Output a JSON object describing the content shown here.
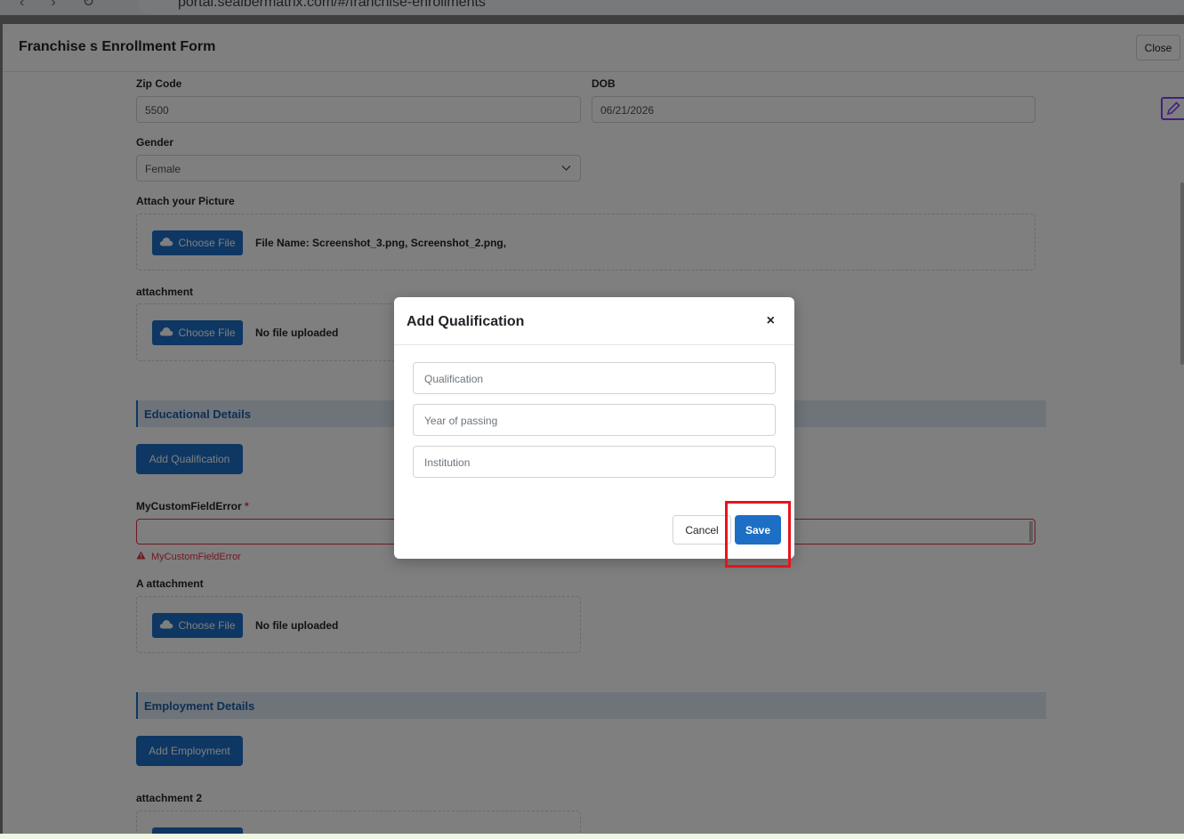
{
  "browser": {
    "url": "portal.sealbermatrix.com/#/franchise-enrollments"
  },
  "header": {
    "title": "Franchise s Enrollment Form",
    "close_label": "Close"
  },
  "form": {
    "zip_label": "Zip Code",
    "zip_value": "5500",
    "dob_label": "DOB",
    "dob_value": "06/21/2026",
    "gender_label": "Gender",
    "gender_value": "Female",
    "picture_label": "Attach your Picture",
    "choose_file_label": "Choose File",
    "picture_file_text": "File Name:  Screenshot_3.png, Screenshot_2.png,",
    "attachment_label": "attachment",
    "no_file_text": "No file uploaded",
    "educational_section": "Educational Details",
    "add_qualification_label": "Add Qualification",
    "custom_field_label": "MyCustomFieldError",
    "required_mark": "*",
    "custom_field_error": "MyCustomFieldError",
    "a_attachment_label": "A attachment",
    "employment_section": "Employment Details",
    "add_employment_label": "Add Employment",
    "attachment2_label": "attachment 2"
  },
  "modal": {
    "title": "Add Qualification",
    "close_symbol": "×",
    "qualification_placeholder": "Qualification",
    "year_placeholder": "Year of passing",
    "institution_placeholder": "Institution",
    "cancel_label": "Cancel",
    "save_label": "Save"
  },
  "colors": {
    "primary": "#1d6fc6",
    "error": "#dc3545",
    "highlight": "#e8141b",
    "section_bg": "#dde8f3"
  }
}
